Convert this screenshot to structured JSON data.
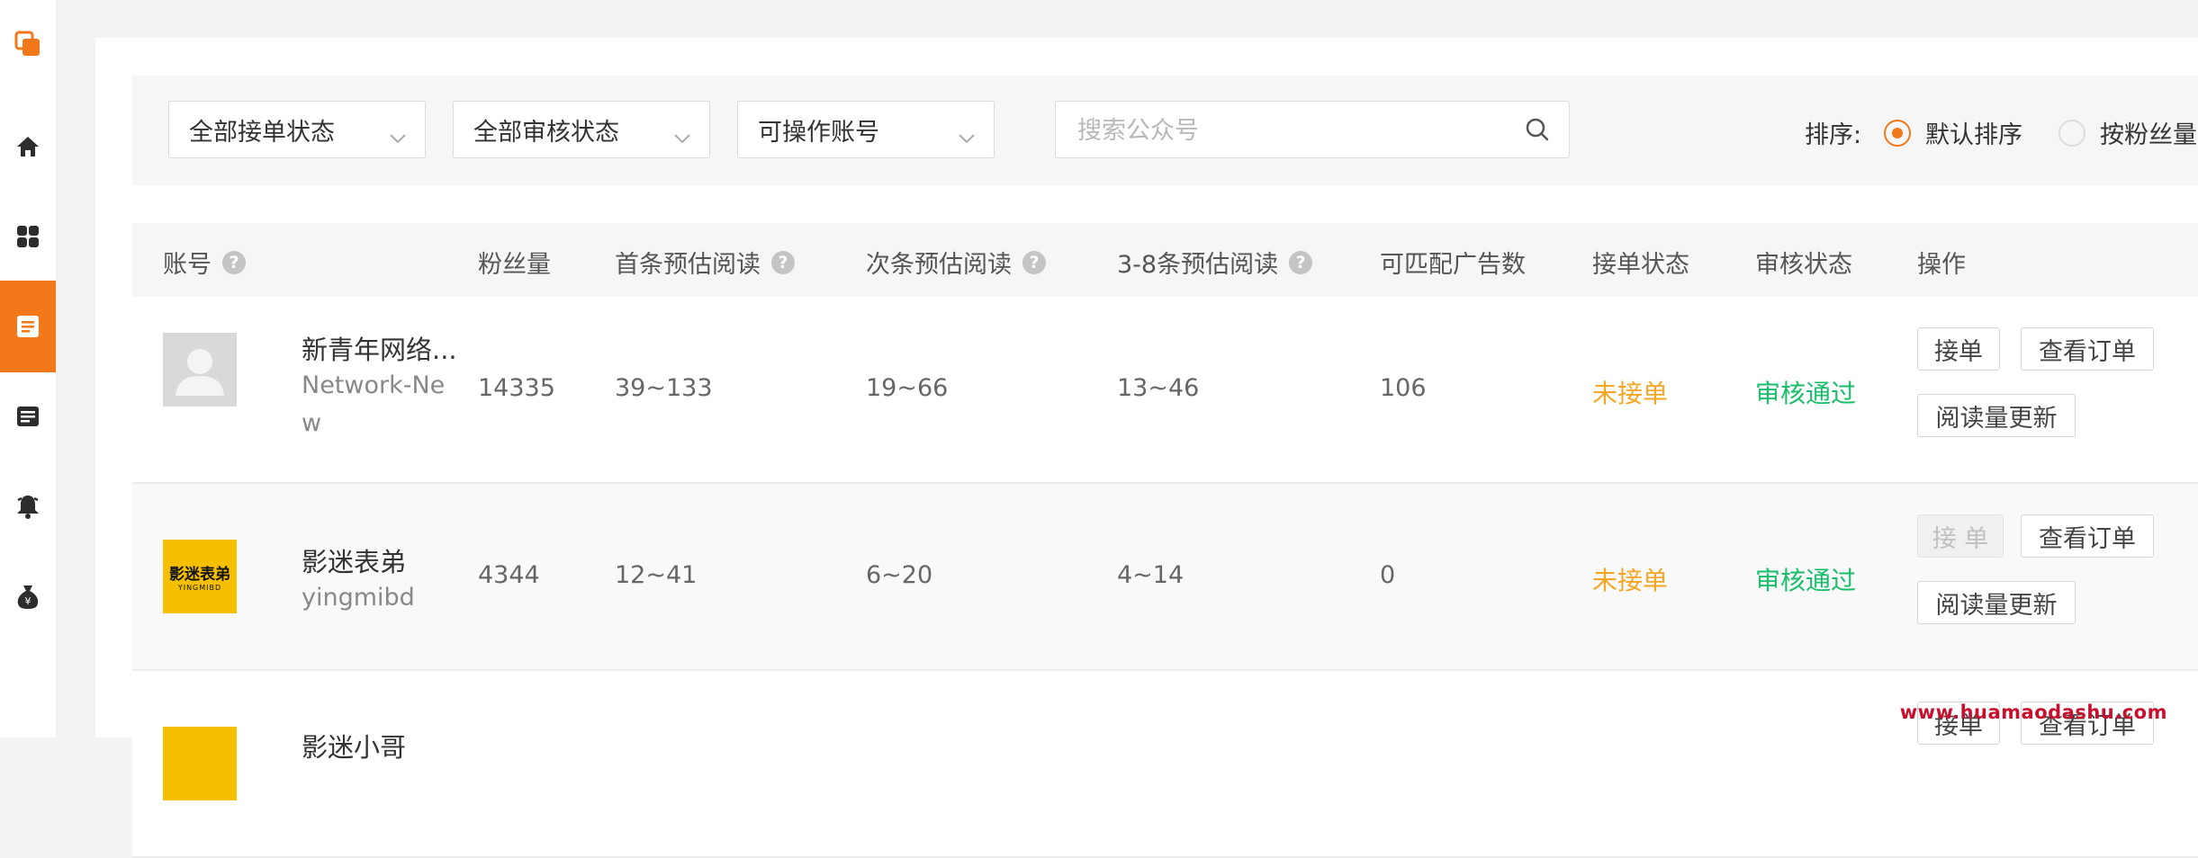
{
  "colors": {
    "accent": "#f2781a",
    "status_pending": "#f5a623",
    "status_approved": "#19be6b"
  },
  "sidebar": {
    "items": [
      {
        "icon": "window-copy-icon",
        "active": false
      },
      {
        "icon": "home-icon",
        "active": false
      },
      {
        "icon": "grid-icon",
        "active": false
      },
      {
        "icon": "document-icon",
        "active": true
      },
      {
        "icon": "list-icon",
        "active": false
      },
      {
        "icon": "bell-icon",
        "active": false
      },
      {
        "icon": "money-bag-icon",
        "active": false
      }
    ]
  },
  "filters": {
    "order_status": "全部接单状态",
    "review_status": "全部审核状态",
    "account_scope": "可操作账号",
    "search_placeholder": "搜索公众号"
  },
  "sort": {
    "label": "排序:",
    "options": [
      {
        "label": "默认排序",
        "selected": true
      },
      {
        "label": "按粉丝量",
        "selected": false
      }
    ]
  },
  "table": {
    "columns": {
      "account": "账号",
      "fans": "粉丝量",
      "first_read": "首条预估阅读",
      "second_read": "次条预估阅读",
      "other_read": "3-8条预估阅读",
      "ad_count": "可匹配广告数",
      "order_status": "接单状态",
      "review_status": "审核状态",
      "actions": "操作"
    },
    "rows": [
      {
        "name": "新青年网络...",
        "account_id": "Network-New",
        "fans": "14335",
        "first_read": "39~133",
        "second_read": "19~66",
        "other_read": "13~46",
        "ad_count": "106",
        "order_status": "未接单",
        "review_status": "审核通过",
        "accept_label": "接单",
        "view_orders_label": "查看订单",
        "update_reads_label": "阅读量更新"
      },
      {
        "name": "影迷表弟",
        "account_id": "yingmibd",
        "avatar_text": "影迷表弟",
        "avatar_sub": "YINGMIBD",
        "fans": "4344",
        "first_read": "12~41",
        "second_read": "6~20",
        "other_read": "4~14",
        "ad_count": "0",
        "order_status": "未接单",
        "review_status": "审核通过",
        "accept_label": "接 单",
        "view_orders_label": "查看订单",
        "update_reads_label": "阅读量更新"
      },
      {
        "name": "影迷小哥",
        "accept_label": "接单",
        "view_orders_label": "查看订单"
      }
    ]
  },
  "watermark": "www.huamaodashu.com"
}
